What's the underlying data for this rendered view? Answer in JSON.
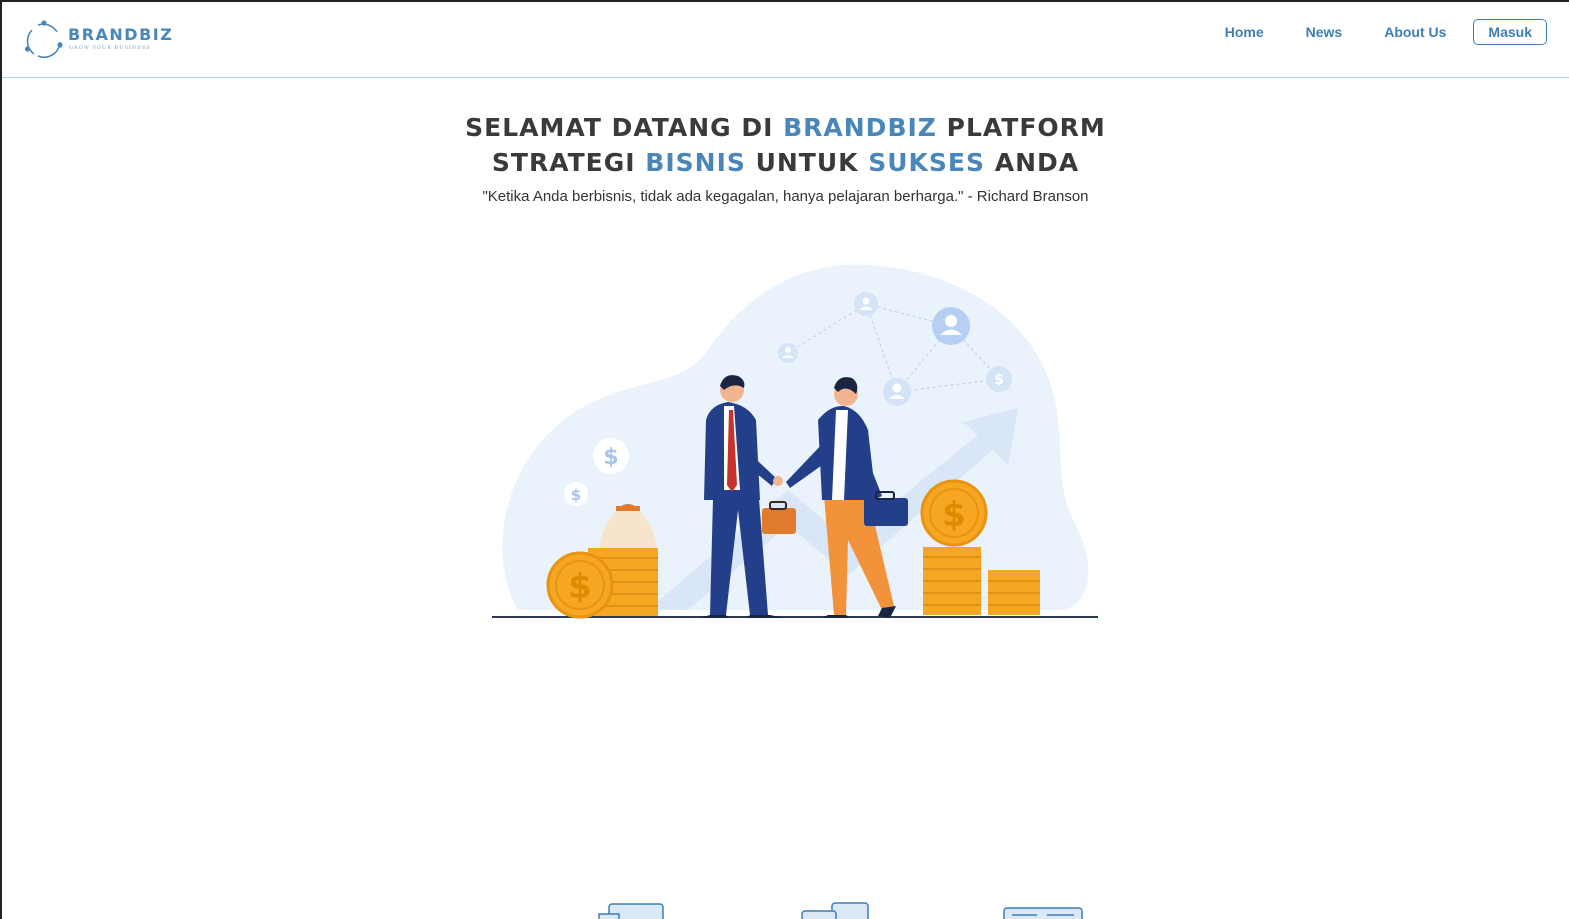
{
  "nav": {
    "logo_name": "BRANDBIZ",
    "logo_tagline": "GROW YOUR BUSINESS",
    "links": [
      "Home",
      "News",
      "About Us"
    ],
    "login_label": "Masuk"
  },
  "hero": {
    "title_line1": {
      "a": "SELAMAT DATANG DI ",
      "b": "BRANDBIZ",
      "c": " PLATFORM"
    },
    "title_line2": {
      "a": "STRATEGI ",
      "b": "BISNIS",
      "c": " UNTUK ",
      "d": "SUKSES",
      "e": " ANDA"
    },
    "quote": "\"Ketika Anda berbisnis, tidak ada kegagalan, hanya pelajaran berharga.\" - Richard Branson"
  },
  "colors": {
    "brand": "#4a86b8",
    "nav": "#3d7fb5",
    "coin": "#f5a623",
    "suit": "#233f8a"
  },
  "icons": {
    "logo": "brandbiz-logo-icon",
    "bottom": [
      "document-icon",
      "devices-icon",
      "browser-icon"
    ]
  }
}
